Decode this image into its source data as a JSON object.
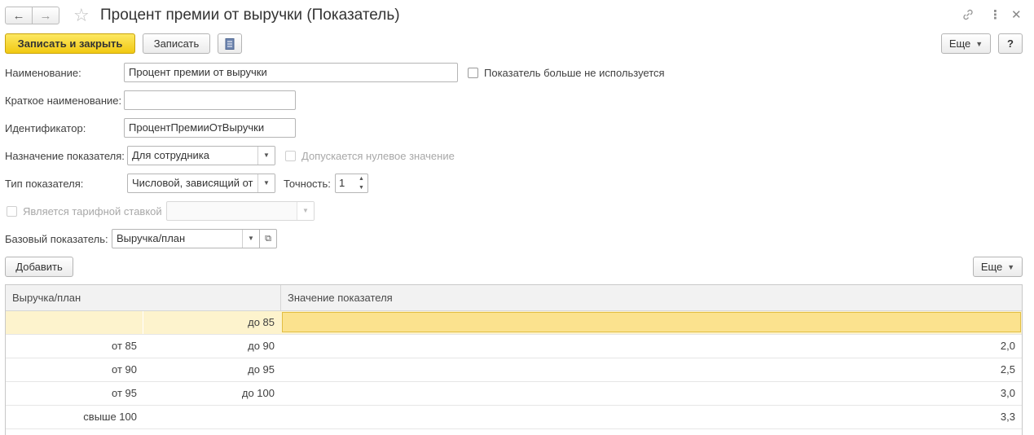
{
  "window": {
    "title": "Процент премии от выручки (Показатель)",
    "icons": {
      "back": "arrow-left-icon",
      "forward": "arrow-right-icon",
      "favorite": "star-icon",
      "link": "link-icon",
      "menu": "more-vertical-icon",
      "close": "close-icon"
    }
  },
  "toolbar": {
    "save_close_label": "Записать и закрыть",
    "save_label": "Записать",
    "report_icon": "document-icon",
    "more_label": "Еще",
    "help_label": "?"
  },
  "form": {
    "name_label": "Наименование:",
    "name_value": "Процент премии от выручки",
    "not_used_label": "Показатель больше не используется",
    "not_used_checked": false,
    "short_name_label": "Краткое наименование:",
    "short_name_value": "",
    "id_label": "Идентификатор:",
    "id_value": "ПроцентПремииОтВыручки",
    "purpose_label": "Назначение показателя:",
    "purpose_value": "Для сотрудника",
    "zero_allowed_label": "Допускается нулевое значение",
    "zero_allowed_checked": false,
    "type_label": "Тип показателя:",
    "type_value": "Числовой, зависящий от",
    "precision_label": "Точность:",
    "precision_value": "1",
    "tariff_label": "Является тарифной ставкой",
    "tariff_value": "",
    "base_label": "Базовый показатель:",
    "base_value": "Выручка/план"
  },
  "table_toolbar": {
    "add_label": "Добавить",
    "more_label": "Еще"
  },
  "table": {
    "columns": [
      "Выручка/план",
      "Значение показателя"
    ],
    "rows": [
      {
        "from": "",
        "to": "до 85",
        "value": ""
      },
      {
        "from": "от 85",
        "to": "до 90",
        "value": "2,0"
      },
      {
        "from": "от 90",
        "to": "до 95",
        "value": "2,5"
      },
      {
        "from": "от 95",
        "to": "до 100",
        "value": "3,0"
      },
      {
        "from": "свыше 100",
        "to": "",
        "value": "3,3"
      }
    ],
    "selected_row": 0
  },
  "colors": {
    "primary_button": "#f1c912",
    "selected_row": "#fdf3cd",
    "active_cell": "#fbe28e"
  }
}
